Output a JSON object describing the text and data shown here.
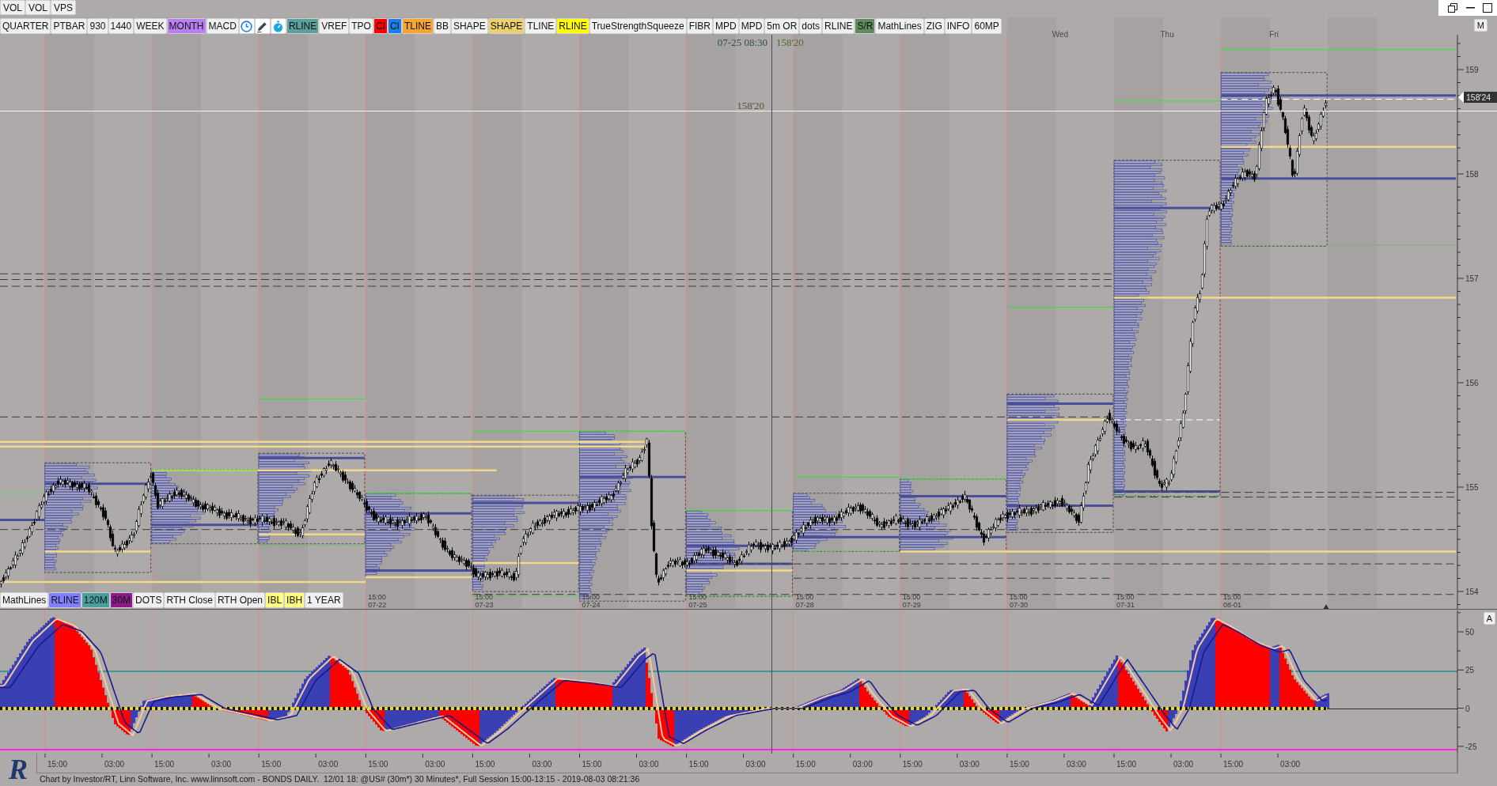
{
  "window": {
    "buttons": [
      "VOL",
      "VOL",
      "VPS"
    ]
  },
  "toolbar": {
    "buttons": [
      {
        "kind": "text",
        "label": "QUARTER",
        "color": "#f0f0f0"
      },
      {
        "kind": "text",
        "label": "PTBAR",
        "color": "#f0f0f0"
      },
      {
        "kind": "text",
        "label": "930",
        "color": "#f0f0f0"
      },
      {
        "kind": "text",
        "label": "1440",
        "color": "#f0f0f0"
      },
      {
        "kind": "text",
        "label": "WEEK",
        "color": "#f0f0f0"
      },
      {
        "kind": "text",
        "label": "MONTH",
        "color": "#b87ff0"
      },
      {
        "kind": "text",
        "label": "MACD",
        "color": "#f0f0f0"
      },
      {
        "kind": "clock"
      },
      {
        "kind": "pencil"
      },
      {
        "kind": "stopwatch"
      },
      {
        "kind": "text",
        "label": "RLINE",
        "color": "#5aa09c"
      },
      {
        "kind": "text",
        "label": "VREF",
        "color": "#f0f0f0"
      },
      {
        "kind": "text",
        "label": "TPO",
        "color": "#f0f0f0"
      },
      {
        "kind": "text",
        "label": "CI",
        "color": "#ff0000"
      },
      {
        "kind": "text",
        "label": "CI",
        "color": "#1a80e8"
      },
      {
        "kind": "text",
        "label": "TLINE",
        "color": "#f5a530"
      },
      {
        "kind": "text",
        "label": "BB",
        "color": "#f0f0f0"
      },
      {
        "kind": "text",
        "label": "SHAPE",
        "color": "#f0f0f0"
      },
      {
        "kind": "text",
        "label": "SHAPE",
        "color": "#ecd070"
      },
      {
        "kind": "text",
        "label": "TLINE",
        "color": "#f0f0f0"
      },
      {
        "kind": "text",
        "label": "RLINE",
        "color": "#ffff00"
      },
      {
        "kind": "text",
        "label": "TrueStrengthSqueeze",
        "color": "#f0f0f0"
      },
      {
        "kind": "text",
        "label": "FIBR",
        "color": "#f0f0f0"
      },
      {
        "kind": "text",
        "label": "MPD",
        "color": "#f0f0f0"
      },
      {
        "kind": "text",
        "label": "MPD",
        "color": "#f0f0f0"
      },
      {
        "kind": "text",
        "label": "5m OR",
        "color": "#f0f0f0"
      },
      {
        "kind": "text",
        "label": "dots",
        "color": "#f0f0f0"
      },
      {
        "kind": "text",
        "label": "RLINE",
        "color": "#f0f0f0"
      },
      {
        "kind": "text",
        "label": "S/R",
        "color": "#5f8b5f"
      },
      {
        "kind": "text",
        "label": "MathLines",
        "color": "#f0f0f0"
      },
      {
        "kind": "text",
        "label": "ZIG",
        "color": "#f0f0f0"
      },
      {
        "kind": "text",
        "label": "INFO",
        "color": "#f0f0f0"
      },
      {
        "kind": "text",
        "label": "60MP",
        "color": "#f0f0f0"
      }
    ]
  },
  "price_chart": {
    "corner_button": "M",
    "day_labels": [
      "Wed",
      "Thu",
      "Fri"
    ],
    "crosshair": {
      "time": "07-25 08:30",
      "price": "158'20",
      "cursor_price": "158'20"
    },
    "last_price": "158'24",
    "price_axis": [
      "159",
      "158",
      "157",
      "156",
      "155",
      "154"
    ],
    "session_labels": [
      {
        "time": "15:00",
        "date": "07-22"
      },
      {
        "time": "15:00",
        "date": "07-23"
      },
      {
        "time": "15:00",
        "date": "07-24"
      },
      {
        "time": "15:00",
        "date": "07-25"
      },
      {
        "time": "15:00",
        "date": "07-28"
      },
      {
        "time": "15:00",
        "date": "07-29"
      },
      {
        "time": "15:00",
        "date": "07-30"
      },
      {
        "time": "15:00",
        "date": "07-31"
      },
      {
        "time": "15:00",
        "date": "08-01"
      }
    ],
    "indicator_buttons": [
      {
        "label": "MathLines",
        "color": "#f0f0f0"
      },
      {
        "label": "RLINE",
        "color": "#8080ff"
      },
      {
        "label": "120M",
        "color": "#4a9e9e"
      },
      {
        "label": "30M",
        "color": "#8b1b8b"
      },
      {
        "label": "DOTS",
        "color": "#f0f0f0"
      },
      {
        "label": "RTH Close",
        "color": "#f0f0f0"
      },
      {
        "label": "RTH Open",
        "color": "#f0f0f0"
      },
      {
        "label": "IBL",
        "color": "#ffff80"
      },
      {
        "label": "IBH",
        "color": "#ffff80"
      },
      {
        "label": "1 YEAR",
        "color": "#f0f0f0"
      }
    ]
  },
  "oscillator": {
    "corner_button": "A",
    "axis": [
      "50",
      "25",
      "0",
      "-25"
    ]
  },
  "time_axis": [
    "15:00",
    "03:00",
    "15:00",
    "03:00",
    "15:00",
    "03:00",
    "15:00",
    "03:00",
    "15:00",
    "03:00",
    "15:00",
    "03:00",
    "15:00",
    "03:00",
    "15:00",
    "03:00",
    "15:00",
    "03:00",
    "15:00",
    "03:00",
    "15:00",
    "03:00",
    "15:00",
    "03:00"
  ],
  "logo": "R",
  "status_bar": "Chart by Investor/RT, Linn Software, Inc. www.linnsoft.com - BONDS DAILY.  12/01 18: @US# (30m*) 30 Minutes*, Full Session 15:00-13:15 - 2019-08-03 08:21:36"
}
